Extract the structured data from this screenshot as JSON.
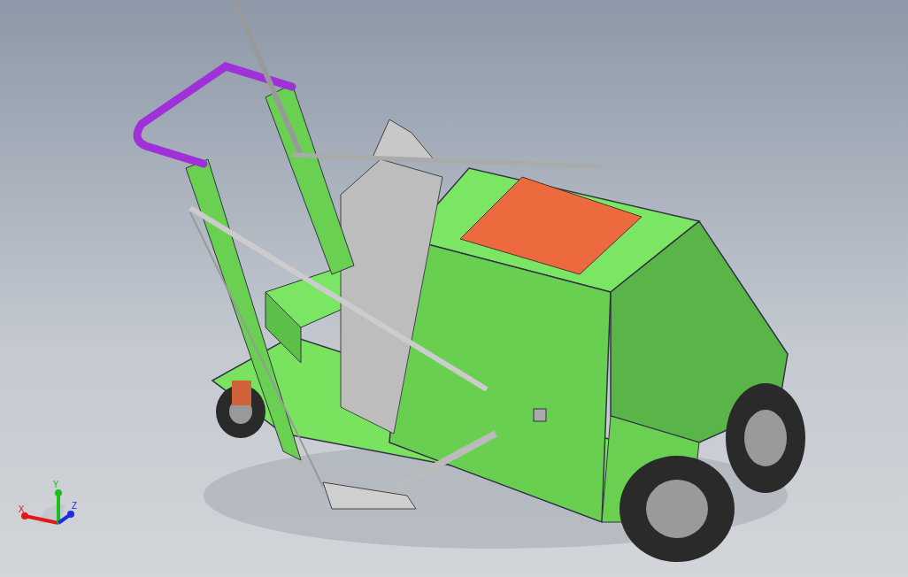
{
  "viewport": {
    "triad": {
      "axes": [
        {
          "label": "X",
          "color": "#e01818"
        },
        {
          "label": "Y",
          "color": "#18c018"
        },
        {
          "label": "Z",
          "color": "#1830e0"
        }
      ]
    }
  }
}
